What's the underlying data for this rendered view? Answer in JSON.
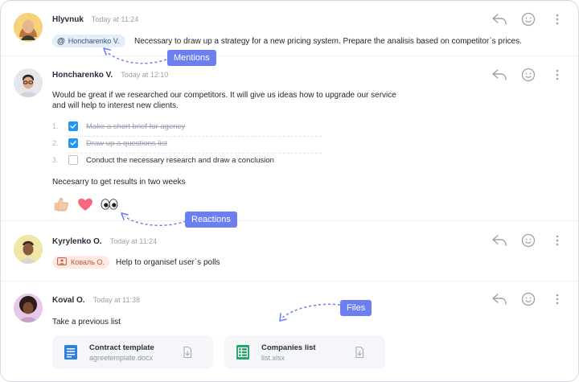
{
  "messages": [
    {
      "author": "Hlyvnuk",
      "time": "Today at 11:24",
      "mention": "Honcharenko V.",
      "text": "Necessary to draw up a strategy for a new pricing system. Prepare the analisis based on competitor`s prices."
    },
    {
      "author": "Honcharenko V.",
      "time": "Today at 12:10",
      "text_line1": "Would be great if we researched our competitors. It will give us ideas how to upgrade our service",
      "text_line2": "and will help to interest new clients.",
      "checklist": [
        {
          "num": "1.",
          "label": "Make a short brief for agency",
          "checked": true
        },
        {
          "num": "2.",
          "label": "Draw up a questions list",
          "checked": true
        },
        {
          "num": "3.",
          "label": "Conduct the necessary research and draw a conclusion",
          "checked": false
        }
      ],
      "footer": "Necesarry to get results in two weeks",
      "reactions": [
        "thumbs-up",
        "heart",
        "eyes"
      ]
    },
    {
      "author": "Kyrylenko O.",
      "time": "Today at 11:24",
      "tag": "Коваль О.",
      "text": "Help to organisef user`s polls"
    },
    {
      "author": "Koval O.",
      "time": "Today at 11:38",
      "text": "Take a previous list",
      "files": [
        {
          "name": "Contract template",
          "filename": "agreetemplate.docx",
          "icon": "doc-icon",
          "color": "#2f7fe0"
        },
        {
          "name": "Companies list",
          "filename": "list.xlsx",
          "icon": "sheet-icon",
          "color": "#21a366"
        }
      ]
    }
  ],
  "callouts": {
    "mentions": "Mentions",
    "reactions": "Reactions",
    "files": "Files"
  },
  "colors": {
    "accent": "#6c7ff0",
    "checkbox": "#2196f3",
    "mention_bg": "#e4eefb",
    "tag_bg": "#fde9e2"
  }
}
